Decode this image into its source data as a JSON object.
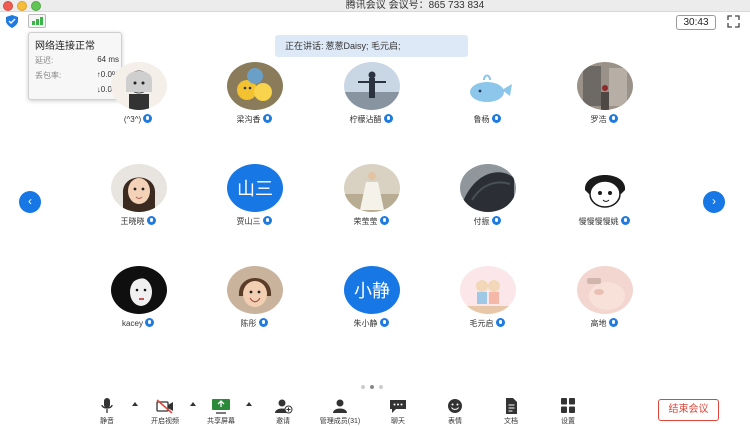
{
  "window": {
    "title": "腾讯会议 会议号：865 733 834"
  },
  "timer": "30:43",
  "network": {
    "status": "网络连接正常",
    "latency_label": "延迟:",
    "latency_value": "64 ms",
    "loss_label": "丢包率:",
    "loss_up": "↑0.0%",
    "loss_down": "↓0.0%"
  },
  "speaking": {
    "label": "正在讲话:",
    "names": "葱葱Daisy; 毛元启;"
  },
  "participants": [
    {
      "name": "(^3^)",
      "avatar": "anime-girl-icon"
    },
    {
      "name": "梁沟香",
      "avatar": "fruit-emoji-icon"
    },
    {
      "name": "柠檬沾醋",
      "avatar": "person-sky-icon"
    },
    {
      "name": "鲁杨",
      "avatar": "whale-icon"
    },
    {
      "name": "罗浩",
      "avatar": "street-icon"
    },
    {
      "name": "王晓晓",
      "avatar": "child-portrait-icon"
    },
    {
      "name": "贾山三",
      "avatar_text": "山三"
    },
    {
      "name": "荣莹莹",
      "avatar": "dress-portrait-icon"
    },
    {
      "name": "付振",
      "avatar": "dark-cloth-icon"
    },
    {
      "name": "慢慢慢慢姚",
      "avatar": "cartoon-face-icon"
    },
    {
      "name": "kacey",
      "avatar": "sketch-portrait-icon"
    },
    {
      "name": "陈彤",
      "avatar": "child-smile-icon"
    },
    {
      "name": "朱小静",
      "avatar_text": "小静"
    },
    {
      "name": "毛元启",
      "avatar": "cartoon-couple-icon"
    },
    {
      "name": "高地",
      "avatar": "baby-icon"
    }
  ],
  "nav": {
    "prev": "‹",
    "next": "›"
  },
  "toolbar": {
    "mute": "静音",
    "video": "开启视频",
    "share": "共享屏幕",
    "invite": "邀请",
    "members": "管理成员(31)",
    "chat": "聊天",
    "emoji": "表情",
    "docs": "文档",
    "settings": "设置",
    "end": "结束会议"
  },
  "colors": {
    "accent": "#1677e5",
    "end": "#e0463a",
    "banner": "#dde9f6"
  }
}
